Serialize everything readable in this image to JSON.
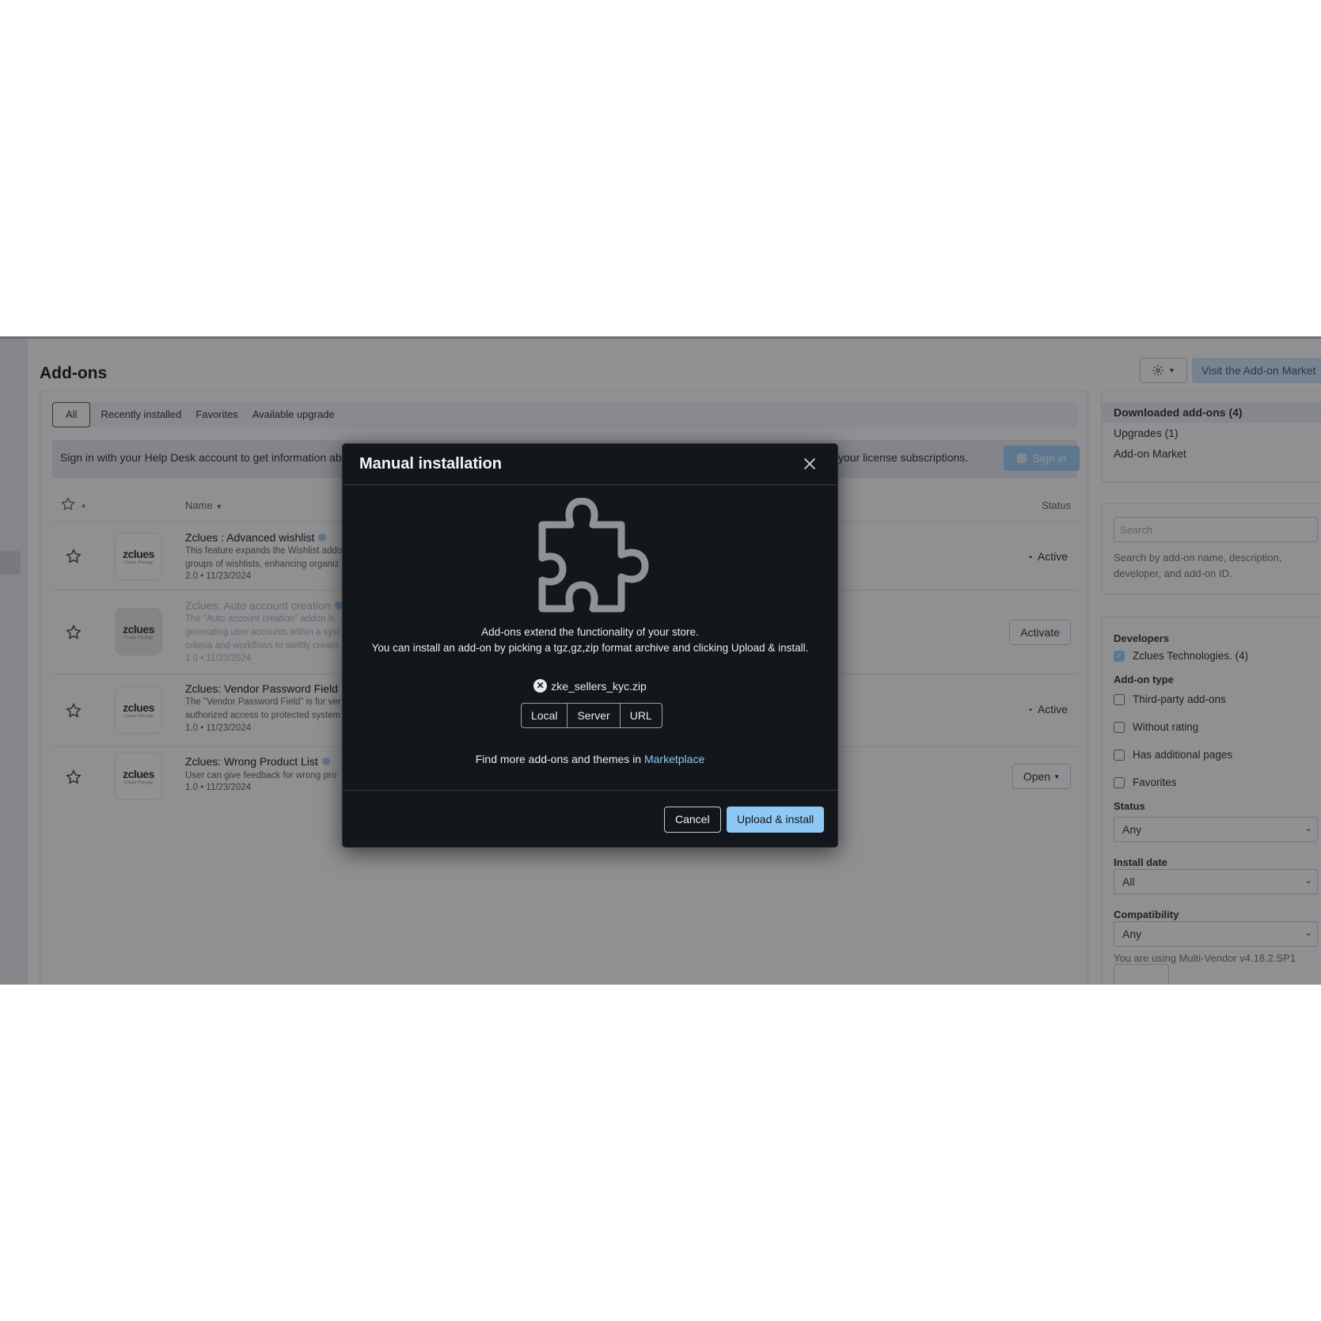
{
  "header": {
    "title": "Add-ons",
    "market_label": "Visit the Add-on Market"
  },
  "tabs": [
    "All",
    "Recently installed",
    "Favorites",
    "Available upgrade"
  ],
  "signin": {
    "message_start": "Sign in with your Help Desk account to get information ab",
    "message_end": "your license subscriptions.",
    "button_label": "Sign in"
  },
  "table": {
    "col_name": "Name",
    "col_status": "Status",
    "logo_brand": "zclues",
    "logo_tagline": "Create Prestige",
    "rows": [
      {
        "title": "Zclues : Advanced wishlist",
        "desc": [
          "This feature expands the Wishlist addo",
          "groups of wishlists, enhancing organiz"
        ],
        "meta": "2.0 • 11/23/2024",
        "status": "Active"
      },
      {
        "title": "Zclues: Auto account creation",
        "desc": [
          "The \"Auto account creation\" addon is",
          "generating user accounts within a syst",
          "criteria and workflows to swiftly create"
        ],
        "meta": "1.0 • 11/23/2024",
        "action": "Activate"
      },
      {
        "title": "Zclues: Vendor Password Field",
        "desc": [
          "The \"Vendor Password Field\" is for ver",
          "authorized access to protected system"
        ],
        "meta": "1.0 • 11/23/2024",
        "status": "Active"
      },
      {
        "title": "Zclues: Wrong Product List",
        "desc": [
          "User can give feedback for wrong pro"
        ],
        "meta": "1.0 • 11/23/2024",
        "action": "Open"
      }
    ]
  },
  "sidebar": {
    "nav": [
      "Downloaded add-ons (4)",
      "Upgrades (1)",
      "Add-on Market"
    ],
    "search_placeholder": "Search",
    "search_hint": "Search by add-on name, description, developer, and add-on ID.",
    "developers_heading": "Developers",
    "developer_option": "Zclues Technologies. (4)",
    "type_heading": "Add-on type",
    "type_options": [
      "Third-party add-ons",
      "Without rating",
      "Has additional pages",
      "Favorites"
    ],
    "status_heading": "Status",
    "status_value": "Any",
    "install_heading": "Install date",
    "install_value": "All",
    "compat_heading": "Compatibility",
    "compat_value": "Any",
    "version_note": "You are using Multi-Vendor v4.18.2.SP1"
  },
  "modal": {
    "title": "Manual installation",
    "intro_line1": "Add-ons extend the functionality of your store.",
    "intro_line2": "You can install an add-on by picking a tgz,gz,zip format archive and clicking Upload & install.",
    "file_name": "zke_sellers_kyc.zip",
    "sources": [
      "Local",
      "Server",
      "URL"
    ],
    "find_more_text": "Find more add-ons and themes in",
    "marketplace_link": "Marketplace",
    "cancel_label": "Cancel",
    "upload_label": "Upload & install"
  }
}
